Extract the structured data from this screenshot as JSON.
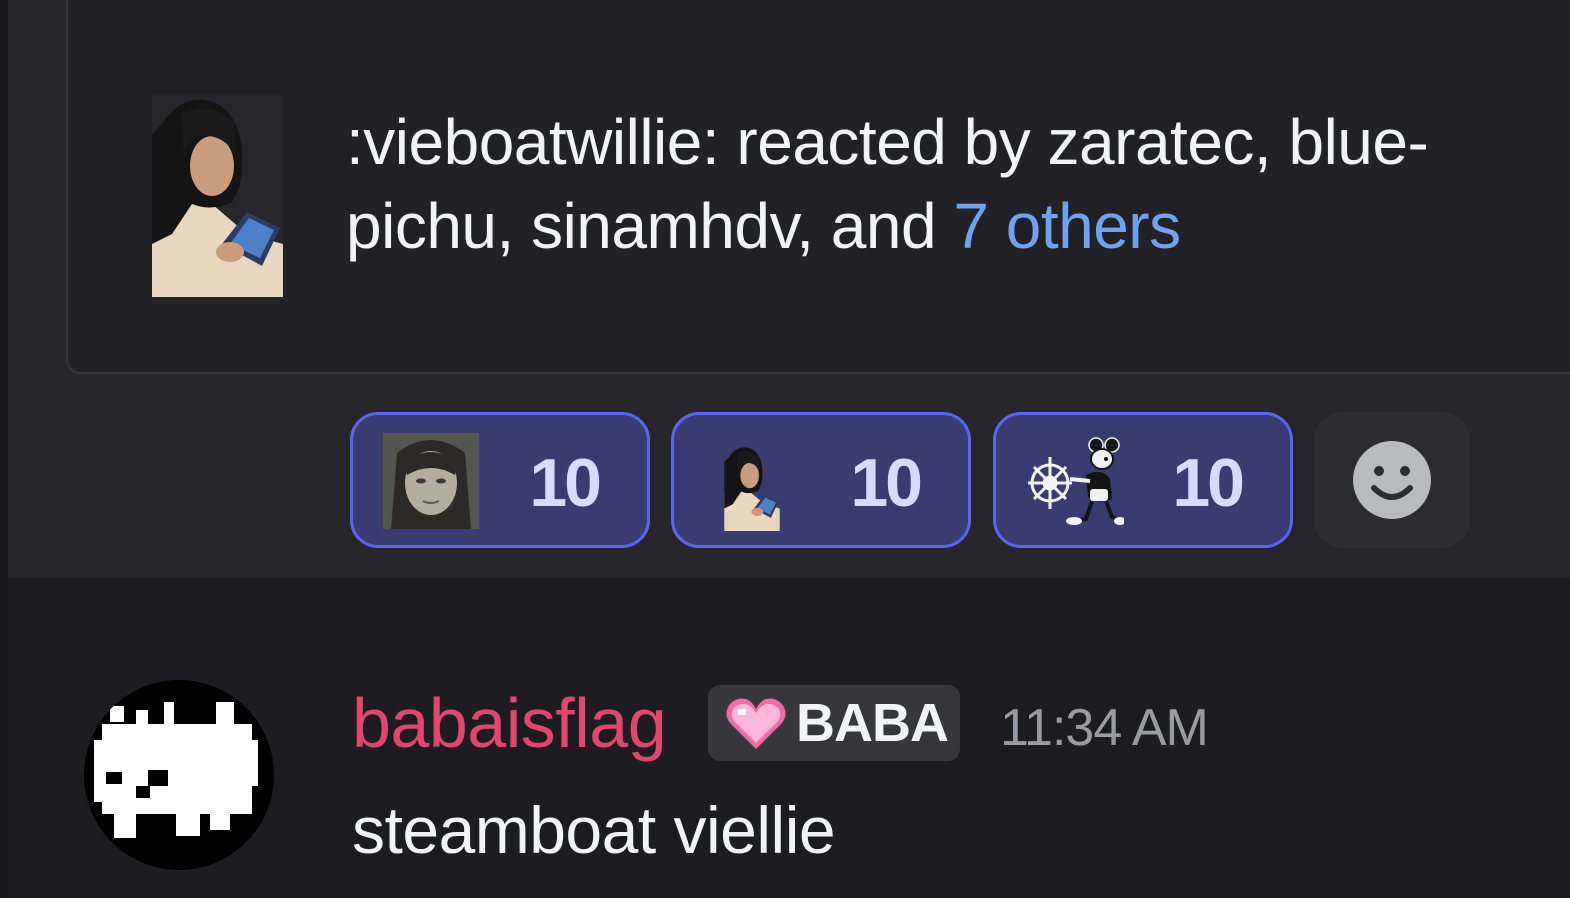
{
  "tooltip": {
    "emoji_icon": "vieboatwillie-custom-emoji",
    "text_prefix": ":vieboatwillie: reacted by zaratec, blue-pichu, sinamhdv, and ",
    "others_link": "7 others"
  },
  "reactions": [
    {
      "emoji_icon": "face-photo-emoji",
      "count": "10"
    },
    {
      "emoji_icon": "vieboatwillie-emoji",
      "count": "10"
    },
    {
      "emoji_icon": "steamboat-willie-emoji",
      "count": "10"
    }
  ],
  "add_reaction_icon": "smiley-add-reaction-icon",
  "message": {
    "avatar_icon": "baba-pixel-avatar",
    "username": "babaisflag",
    "tag_icon": "pink-heart-icon",
    "tag": "BABA",
    "timestamp": "11:34 AM",
    "content": "steamboat viellie"
  },
  "colors": {
    "username": "#e0466f",
    "link": "#6ea3f2",
    "reaction_bg": "#393c70",
    "reaction_border": "#5865f2",
    "background": "#1c1c21"
  }
}
